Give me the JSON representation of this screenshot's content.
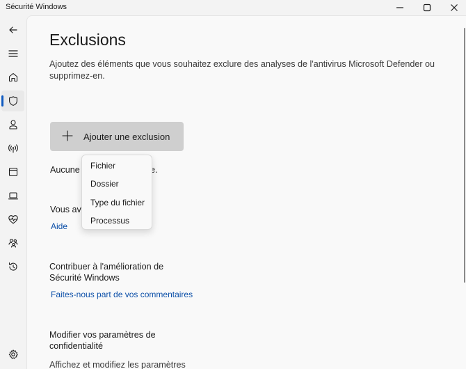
{
  "window": {
    "title": "Sécurité Windows",
    "controls": [
      "minimize-icon",
      "maximize-icon",
      "close-icon"
    ]
  },
  "sidebar": {
    "items": [
      {
        "icon": "back-arrow-icon",
        "name": "back"
      },
      {
        "icon": "hamburger-menu-icon",
        "name": "menu"
      },
      {
        "icon": "home-icon",
        "name": "home"
      },
      {
        "icon": "shield-icon",
        "name": "virus-protection",
        "active": true
      },
      {
        "icon": "person-icon",
        "name": "account-protection"
      },
      {
        "icon": "wireless-icon",
        "name": "firewall-network"
      },
      {
        "icon": "app-browser-icon",
        "name": "app-browser-control"
      },
      {
        "icon": "laptop-icon",
        "name": "device-security"
      },
      {
        "icon": "heart-pulse-icon",
        "name": "device-performance"
      },
      {
        "icon": "family-icon",
        "name": "family-options"
      },
      {
        "icon": "history-icon",
        "name": "protection-history"
      },
      {
        "icon": "gear-icon",
        "name": "settings"
      }
    ],
    "accent": "#0f5ac0"
  },
  "main": {
    "title": "Exclusions",
    "description": "Ajoutez des éléments que vous souhaitez exclure des analyses de l'antivirus Microsoft Defender ou supprimez-en.",
    "add_button_label": "Ajouter une exclusion",
    "none_text_left": "Aucune",
    "none_text_right": "e.",
    "question_text": "Vous ave",
    "help_link": "Aide",
    "contribute_title_line1": "Contribuer à l'amélioration de",
    "contribute_title_line2": "Sécurité Windows",
    "feedback_link": "Faites-nous part de vos commentaires",
    "privacy_title_line1": "Modifier vos paramètres de",
    "privacy_title_line2": "confidentialité",
    "privacy_desc": "Affichez et modifiez les paramètres"
  },
  "dropdown_menu": {
    "items": [
      "Fichier",
      "Dossier",
      "Type du fichier",
      "Processus"
    ]
  }
}
